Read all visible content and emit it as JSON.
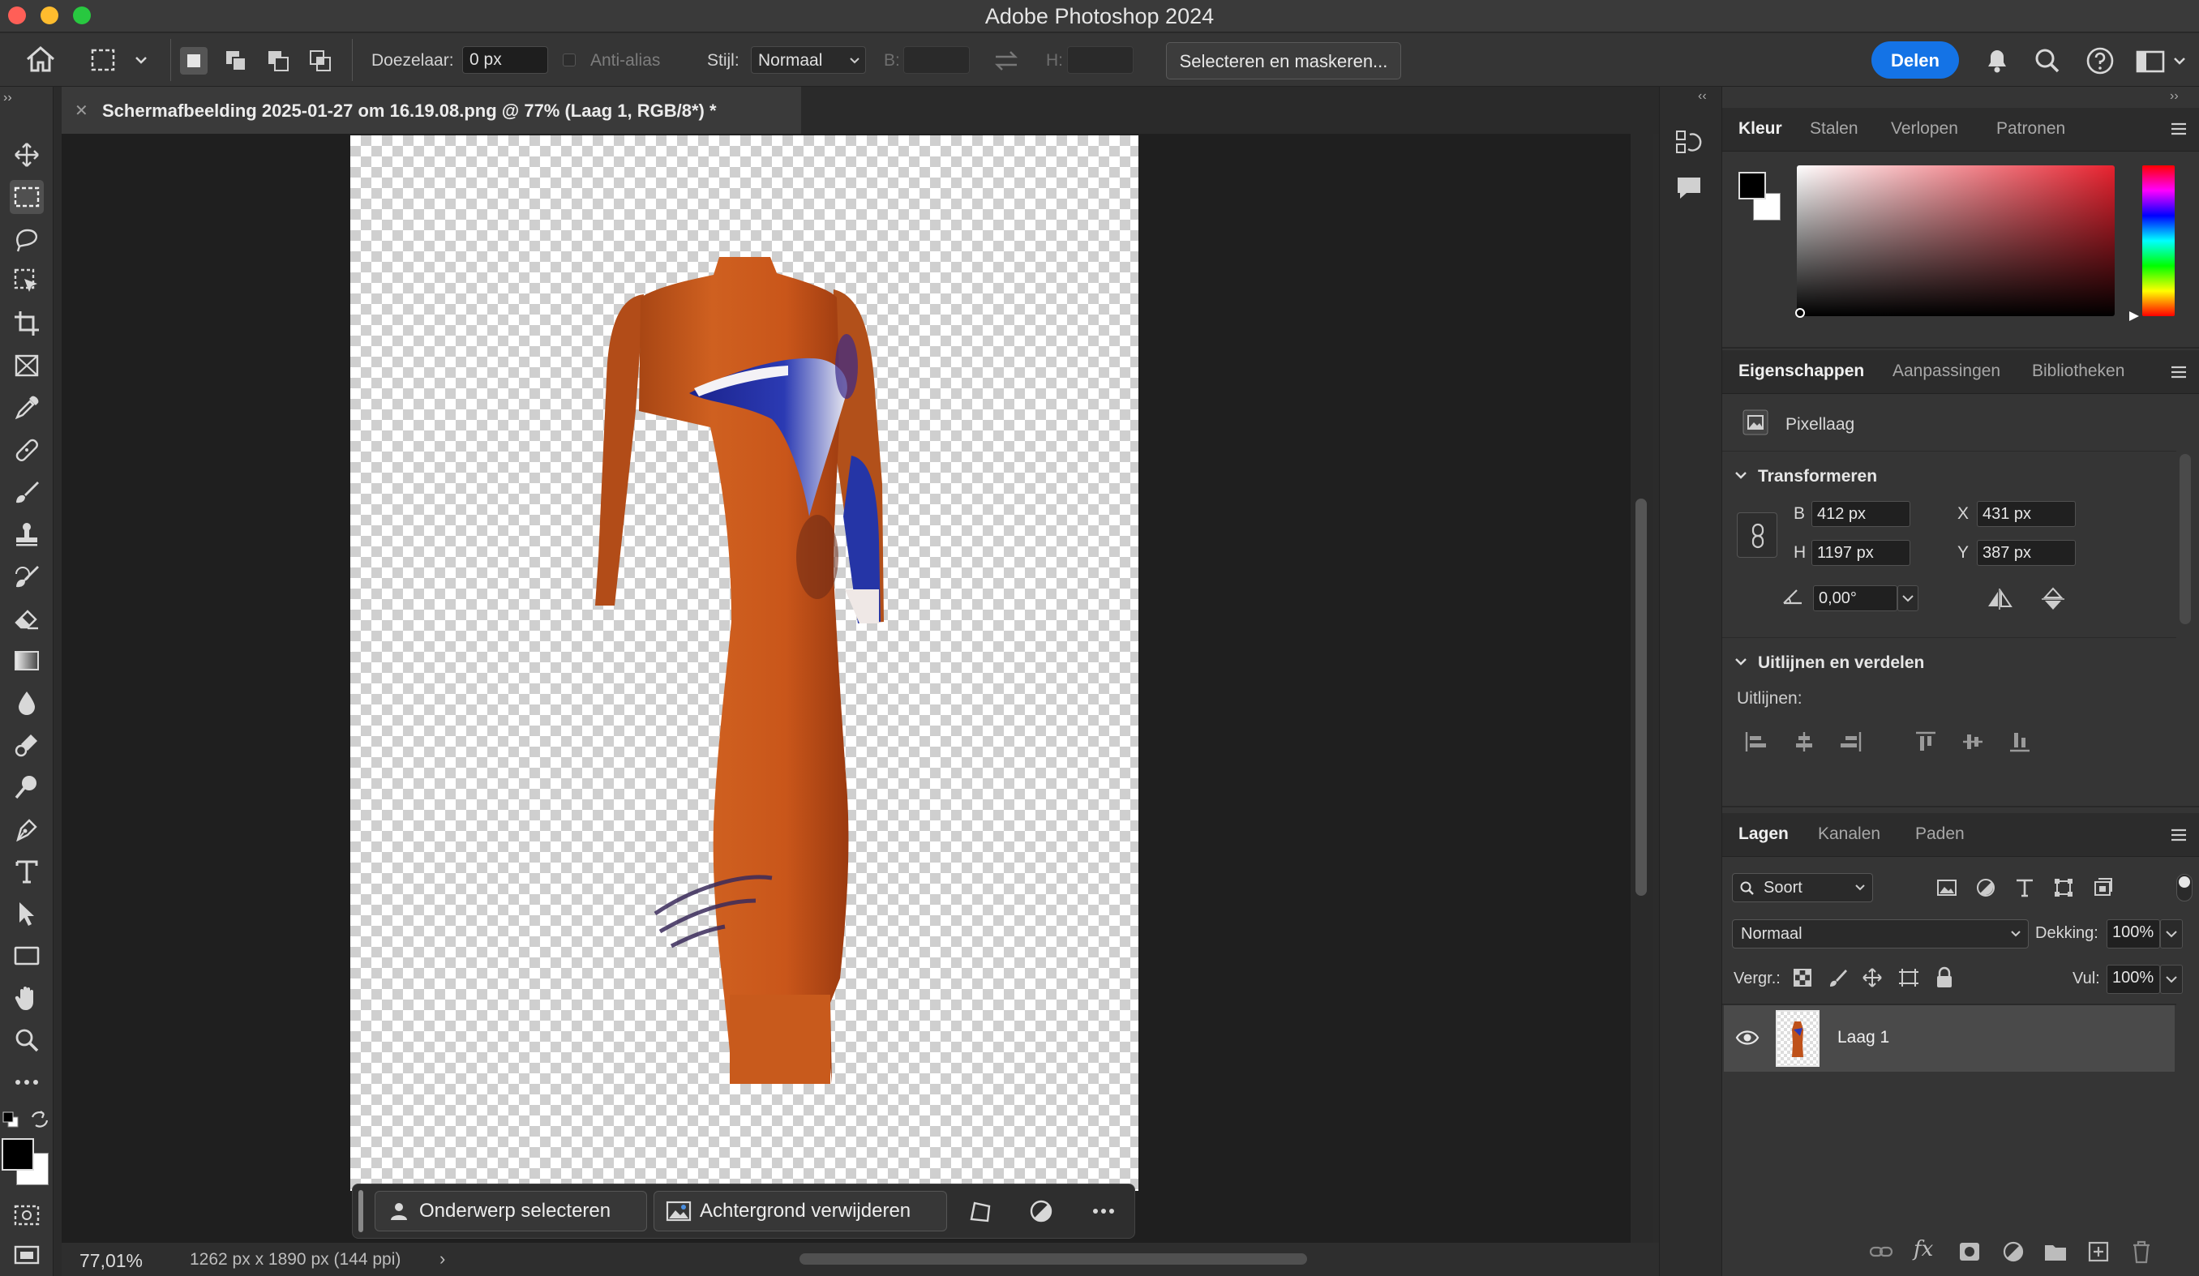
{
  "window": {
    "title": "Adobe Photoshop 2024"
  },
  "options": {
    "feather_label": "Doezelaar:",
    "feather_value": "0 px",
    "antialias_label": "Anti-alias",
    "style_label": "Stijl:",
    "style_value": "Normaal",
    "width_label": "B:",
    "height_label": "H:",
    "select_mask_label": "Selecteren en maskeren...",
    "share_label": "Delen"
  },
  "document": {
    "tab_title": "Schermafbeelding 2025-01-27 om 16.19.08.png @ 77% (Laag 1, RGB/8*) *",
    "zoom": "77,01%",
    "info": "1262 px x 1890 px (144 ppi)"
  },
  "context_bar": {
    "select_subject": "Onderwerp selecteren",
    "remove_background": "Achtergrond verwijderen"
  },
  "color_panel": {
    "tabs": [
      "Kleur",
      "Stalen",
      "Verlopen",
      "Patronen"
    ],
    "foreground": "#000000",
    "background": "#ffffff",
    "hue": "#e8222f"
  },
  "properties_panel": {
    "tabs": [
      "Eigenschappen",
      "Aanpassingen",
      "Bibliotheken"
    ],
    "layer_type": "Pixellaag",
    "transform_title": "Transformeren",
    "w_label": "B",
    "w_value": "412 px",
    "h_label": "H",
    "h_value": "1197 px",
    "x_label": "X",
    "x_value": "431 px",
    "y_label": "Y",
    "y_value": "387 px",
    "angle_value": "0,00°",
    "align_title": "Uitlijnen en verdelen",
    "align_label": "Uitlijnen:"
  },
  "layers_panel": {
    "tabs": [
      "Lagen",
      "Kanalen",
      "Paden"
    ],
    "filter_kind": "Soort",
    "blend_mode": "Normaal",
    "opacity_label": "Dekking:",
    "opacity_value": "100%",
    "lock_label": "Vergr.:",
    "fill_label": "Vul:",
    "fill_value": "100%",
    "layers": [
      {
        "name": "Laag 1",
        "visible": true
      }
    ]
  }
}
